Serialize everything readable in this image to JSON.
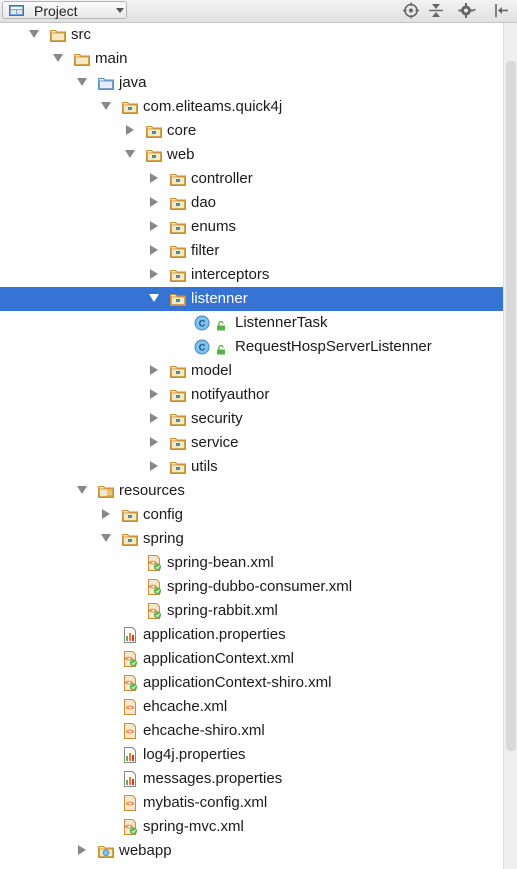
{
  "toolbar": {
    "view_label": "Project",
    "icons": [
      "project-icon",
      "chevron-down-icon",
      "locate-icon",
      "collapse-all-icon",
      "gear-icon",
      "hide-panel-icon"
    ]
  },
  "tree": {
    "items": [
      {
        "label": "src",
        "depth": 0,
        "icon": "folder-icon",
        "toggle": "open"
      },
      {
        "label": "main",
        "depth": 1,
        "icon": "folder-icon",
        "toggle": "open"
      },
      {
        "label": "java",
        "depth": 2,
        "icon": "source-folder-icon",
        "toggle": "open"
      },
      {
        "label": "com.eliteams.quick4j",
        "depth": 3,
        "icon": "package-icon",
        "toggle": "open"
      },
      {
        "label": "core",
        "depth": 4,
        "icon": "package-icon",
        "toggle": "closed"
      },
      {
        "label": "web",
        "depth": 4,
        "icon": "package-icon",
        "toggle": "open"
      },
      {
        "label": "controller",
        "depth": 5,
        "icon": "package-icon",
        "toggle": "closed"
      },
      {
        "label": "dao",
        "depth": 5,
        "icon": "package-icon",
        "toggle": "closed"
      },
      {
        "label": "enums",
        "depth": 5,
        "icon": "package-icon",
        "toggle": "closed"
      },
      {
        "label": "filter",
        "depth": 5,
        "icon": "package-icon",
        "toggle": "closed"
      },
      {
        "label": "interceptors",
        "depth": 5,
        "icon": "package-icon",
        "toggle": "closed"
      },
      {
        "label": "listenner",
        "depth": 5,
        "icon": "package-icon",
        "toggle": "open",
        "selected": true
      },
      {
        "label": "ListennerTask",
        "depth": 6,
        "icon": "java-class-icon",
        "toggle": "none"
      },
      {
        "label": "RequestHospServerListenner",
        "depth": 6,
        "icon": "java-class-icon",
        "toggle": "none"
      },
      {
        "label": "model",
        "depth": 5,
        "icon": "package-icon",
        "toggle": "closed"
      },
      {
        "label": "notifyauthor",
        "depth": 5,
        "icon": "package-icon",
        "toggle": "closed"
      },
      {
        "label": "security",
        "depth": 5,
        "icon": "package-icon",
        "toggle": "closed"
      },
      {
        "label": "service",
        "depth": 5,
        "icon": "package-icon",
        "toggle": "closed"
      },
      {
        "label": "utils",
        "depth": 5,
        "icon": "package-icon",
        "toggle": "closed"
      },
      {
        "label": "resources",
        "depth": 2,
        "icon": "resources-folder-icon",
        "toggle": "open"
      },
      {
        "label": "config",
        "depth": 3,
        "icon": "package-icon",
        "toggle": "closed"
      },
      {
        "label": "spring",
        "depth": 3,
        "icon": "package-icon",
        "toggle": "open"
      },
      {
        "label": "spring-bean.xml",
        "depth": 4,
        "icon": "spring-xml-icon",
        "toggle": "none"
      },
      {
        "label": "spring-dubbo-consumer.xml",
        "depth": 4,
        "icon": "spring-xml-icon",
        "toggle": "none"
      },
      {
        "label": "spring-rabbit.xml",
        "depth": 4,
        "icon": "spring-xml-icon",
        "toggle": "none"
      },
      {
        "label": "application.properties",
        "depth": 3,
        "icon": "properties-icon",
        "toggle": "none"
      },
      {
        "label": "applicationContext.xml",
        "depth": 3,
        "icon": "spring-xml-icon",
        "toggle": "none"
      },
      {
        "label": "applicationContext-shiro.xml",
        "depth": 3,
        "icon": "spring-xml-icon",
        "toggle": "none"
      },
      {
        "label": "ehcache.xml",
        "depth": 3,
        "icon": "xml-icon",
        "toggle": "none"
      },
      {
        "label": "ehcache-shiro.xml",
        "depth": 3,
        "icon": "xml-icon",
        "toggle": "none"
      },
      {
        "label": "log4j.properties",
        "depth": 3,
        "icon": "properties-icon",
        "toggle": "none"
      },
      {
        "label": "messages.properties",
        "depth": 3,
        "icon": "properties-icon",
        "toggle": "none"
      },
      {
        "label": "mybatis-config.xml",
        "depth": 3,
        "icon": "xml-icon",
        "toggle": "none"
      },
      {
        "label": "spring-mvc.xml",
        "depth": 3,
        "icon": "spring-xml-icon",
        "toggle": "none"
      },
      {
        "label": "webapp",
        "depth": 2,
        "icon": "web-folder-icon",
        "toggle": "closed"
      }
    ]
  },
  "colors": {
    "selection": "#3574d4",
    "folder": "#d9a54c",
    "package_dot": "#5a7fae",
    "class_circle": "#5aa7e0",
    "spring_green": "#5bb349",
    "xml_orange": "#e07a28"
  }
}
